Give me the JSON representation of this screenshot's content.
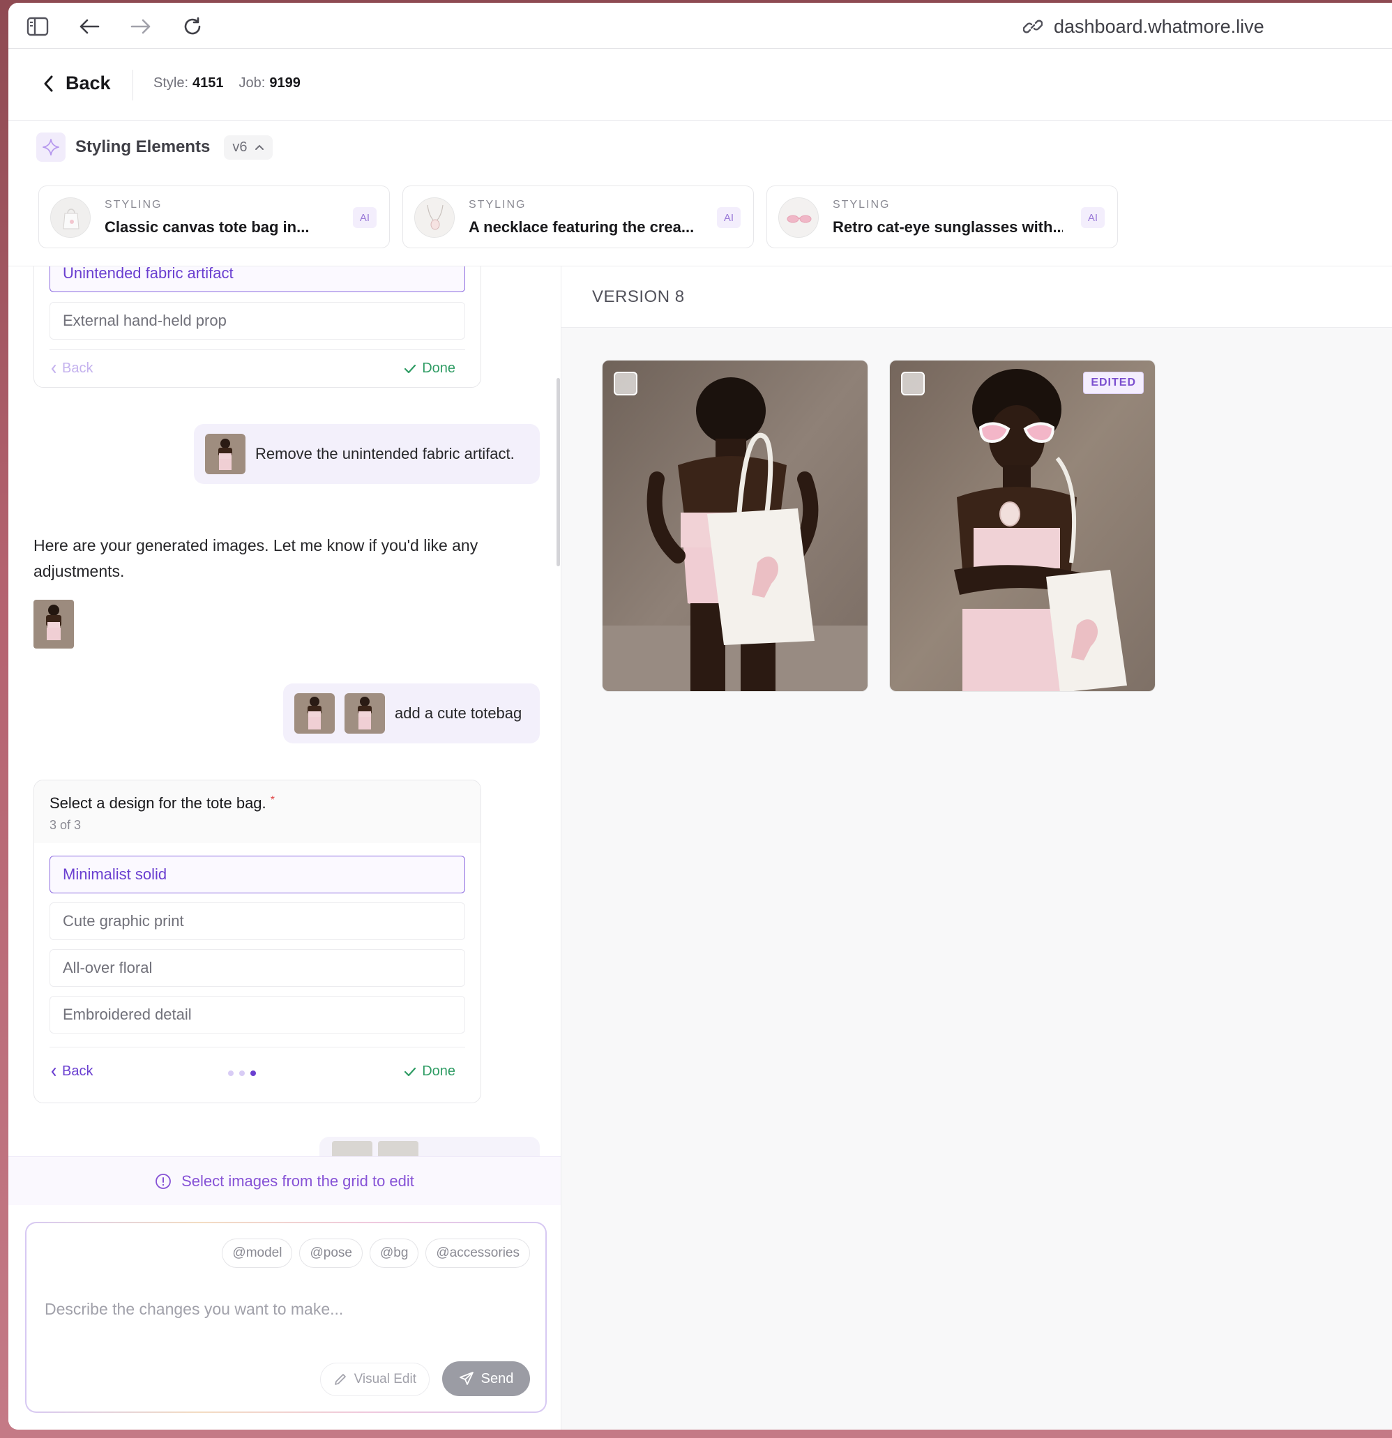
{
  "browser": {
    "url": "dashboard.whatmore.live"
  },
  "header": {
    "back_label": "Back",
    "style_label": "Style:",
    "style_value": "4151",
    "job_label": "Job:",
    "job_value": "9199"
  },
  "styling": {
    "title": "Styling Elements",
    "version": "v6",
    "cards": [
      {
        "kicker": "STYLING",
        "title": "Classic canvas tote bag in...",
        "badge": "AI"
      },
      {
        "kicker": "STYLING",
        "title": "A necklace featuring the crea...",
        "badge": "AI"
      },
      {
        "kicker": "STYLING",
        "title": "Retro cat-eye sunglasses with...",
        "badge": "AI"
      }
    ]
  },
  "chat": {
    "q1": {
      "options": [
        "Unintended fabric artifact",
        "External hand-held prop"
      ],
      "selected_index": 0,
      "back": "Back",
      "done": "Done"
    },
    "user_msg_1": "Remove the unintended fabric artifact.",
    "assistant_msg": "Here are your generated images. Let me know if you'd like any adjustments.",
    "user_msg_2": "add a cute totebag",
    "q2": {
      "question": "Select a design for the tote bag.",
      "required_mark": "*",
      "progress": "3 of 3",
      "options": [
        "Minimalist solid",
        "Cute graphic print",
        "All-over floral",
        "Embroidered detail"
      ],
      "selected_index": 0,
      "back": "Back",
      "done": "Done"
    },
    "notice": "Select images from the grid to edit"
  },
  "composer": {
    "tags": [
      "@model",
      "@pose",
      "@bg",
      "@accessories"
    ],
    "placeholder": "Describe the changes you want to make...",
    "visual_edit": "Visual Edit",
    "send": "Send"
  },
  "results": {
    "version_label": "VERSION 8",
    "images": [
      {
        "name": "back-view-tote",
        "edited": false
      },
      {
        "name": "front-view-sunglasses-necklace-tote",
        "edited": true,
        "edited_label": "EDITED"
      }
    ]
  },
  "colors": {
    "accent": "#6a3fd0",
    "done_green": "#2f9c64",
    "send_gray": "#9b9ca4"
  }
}
